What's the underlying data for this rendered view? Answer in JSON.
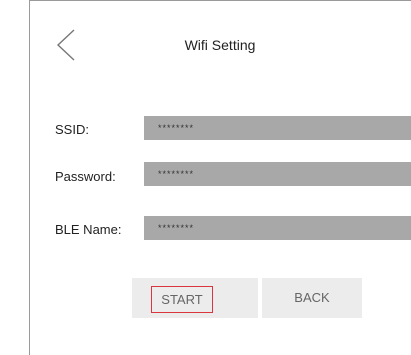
{
  "header": {
    "title": "Wifi Setting",
    "back_icon": "chevron-left-icon"
  },
  "form": {
    "ssid": {
      "label": "SSID:",
      "value": "********"
    },
    "password": {
      "label": "Password:",
      "value": "********"
    },
    "ble_name": {
      "label": "BLE Name:",
      "value": "********"
    }
  },
  "actions": {
    "start_label": "START",
    "back_label": "BACK"
  },
  "colors": {
    "field_bg": "#a8a8a8",
    "button_bg": "#ececec",
    "focus_outline": "#d9363e"
  }
}
